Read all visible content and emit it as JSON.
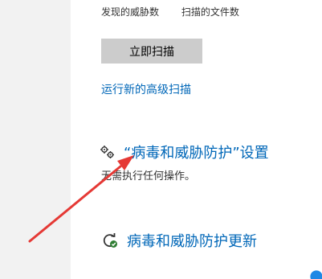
{
  "stats": {
    "threats_found_label": "发现的威胁数",
    "files_scanned_label": "扫描的文件数"
  },
  "scan": {
    "button_label": "立即扫描"
  },
  "advanced": {
    "link_label": "运行新的高级扫描"
  },
  "protection_settings": {
    "icon": "gears-icon",
    "link_label": "“病毒和威胁防护”设置",
    "description": "无需执行任何操作。"
  },
  "protection_updates": {
    "icon": "refresh-check-icon",
    "link_label": "病毒和威胁防护更新"
  },
  "colors": {
    "link": "#0067b8",
    "button_bg": "#cccccc",
    "annotation_arrow": "#e53935"
  }
}
